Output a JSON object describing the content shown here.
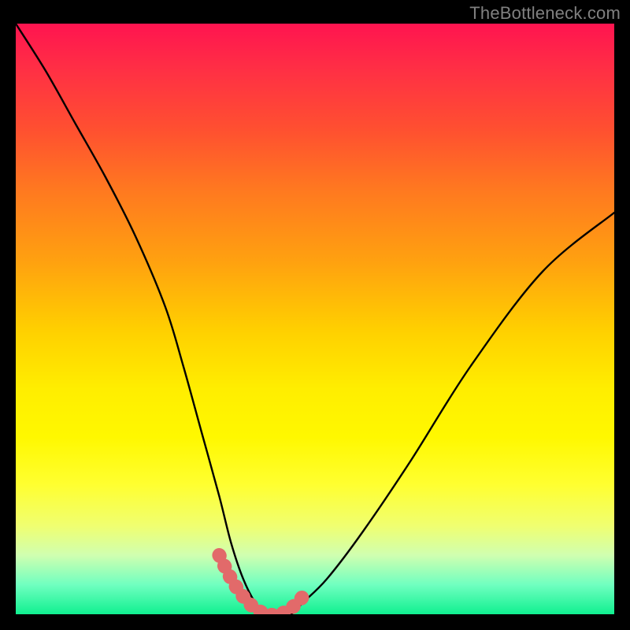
{
  "attribution": "TheBottleneck.com",
  "chart_data": {
    "type": "line",
    "title": "",
    "xlabel": "",
    "ylabel": "",
    "x_range": [
      0,
      100
    ],
    "y_range": [
      0,
      100
    ],
    "series": [
      {
        "name": "bottleneck-curve",
        "x": [
          0,
          5,
          10,
          15,
          20,
          25,
          28,
          31,
          34,
          36,
          38,
          40,
          42,
          44,
          46,
          48,
          52,
          58,
          66,
          76,
          88,
          100
        ],
        "values": [
          100,
          92,
          83,
          74,
          64,
          52,
          42,
          31,
          20,
          12,
          6,
          2,
          0,
          0,
          0,
          2,
          6,
          14,
          26,
          42,
          58,
          68
        ]
      }
    ],
    "highlight": {
      "name": "optimal-region",
      "x": [
        34,
        36,
        38,
        40,
        42,
        44,
        46,
        48
      ],
      "values": [
        10,
        6,
        3,
        1,
        0,
        0,
        1,
        3
      ]
    },
    "background_gradient_meaning": "red=high bottleneck, green=low bottleneck"
  }
}
